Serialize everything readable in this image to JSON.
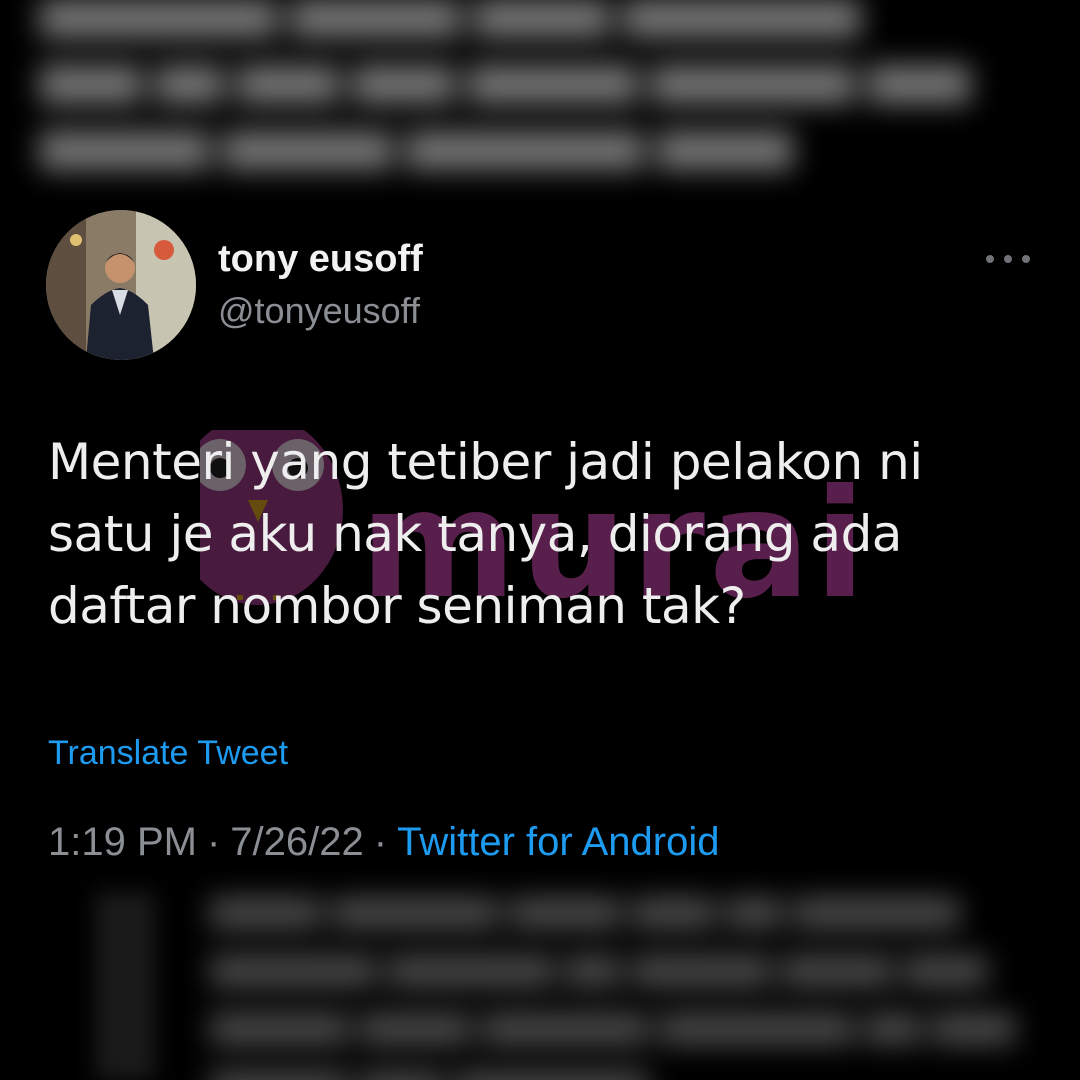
{
  "tweet": {
    "display_name": "tony eusoff",
    "handle": "@tonyeusoff",
    "text_lines": [
      "Menteri yang tetiber jadi pelakon ni",
      "satu je aku nak tanya, diorang ada",
      "daftar nombor seniman tak?"
    ],
    "translate_label": "Translate Tweet",
    "time": "1:19 PM",
    "date": "7/26/22",
    "separator": "·",
    "source": "Twitter for Android"
  },
  "watermark": {
    "text": "murai"
  },
  "icons": {
    "more": "more-options-icon",
    "avatar": "avatar-photo",
    "logo": "owl-logo-icon"
  },
  "colors": {
    "background": "#000000",
    "text": "#eeeeee",
    "muted": "#8b8f94",
    "link": "#1d9bf0",
    "watermark": "#a03a8a"
  }
}
